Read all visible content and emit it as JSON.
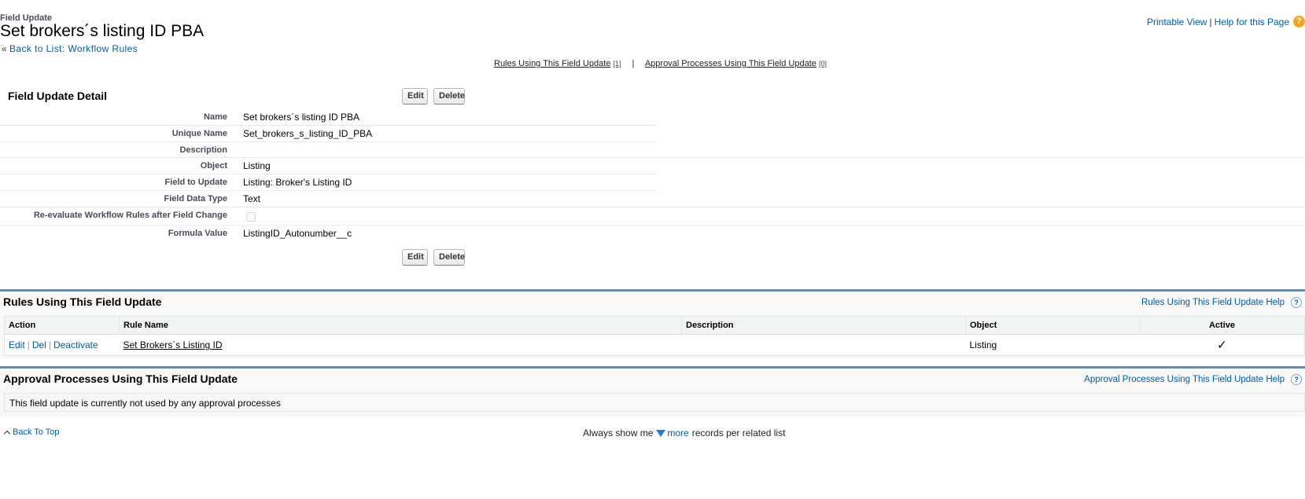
{
  "header": {
    "page_type": "Field Update",
    "title": "Set brokers´s listing ID PBA",
    "back_prefix": "«",
    "back_link": "Back to List: Workflow Rules",
    "printable_view": "Printable View",
    "separator": "|",
    "help_page": "Help for this Page",
    "help_icon": "?"
  },
  "jump_links": {
    "rules": "Rules Using This Field Update",
    "rules_count": "[1]",
    "bar": "|",
    "approvals": "Approval Processes Using This Field Update",
    "approvals_count": "[0]"
  },
  "detail": {
    "title": "Field Update Detail",
    "edit_label": "Edit",
    "delete_label": "Delete",
    "fields": [
      {
        "label": "Name",
        "value": "Set brokers´s listing ID PBA"
      },
      {
        "label": "Unique Name",
        "value": "Set_brokers_s_listing_ID_PBA"
      },
      {
        "label": "Description",
        "value": ""
      },
      {
        "label": "Object",
        "value": "Listing"
      },
      {
        "label": "Field to Update",
        "value": "Listing: Broker's Listing ID"
      },
      {
        "label": "Field Data Type",
        "value": "Text"
      },
      {
        "label": "Re-evaluate Workflow Rules after Field Change",
        "value": ""
      },
      {
        "label": "Formula Value",
        "value": "ListingID_Autonumber__c"
      }
    ],
    "reevaluate_checked": false
  },
  "rules_section": {
    "title": "Rules Using This Field Update",
    "help_link": "Rules Using This Field Update Help",
    "columns": [
      "Action",
      "Rule Name",
      "Description",
      "Object",
      "Active"
    ],
    "rows": [
      {
        "edit": "Edit",
        "del": "Del",
        "deactivate": "Deactivate",
        "pipe": "|",
        "rule_name": "Set Brokers´s Listing ID",
        "description": "",
        "object": "Listing",
        "active": "✓"
      }
    ]
  },
  "approval_section": {
    "title": "Approval Processes Using This Field Update",
    "help_link": "Approval Processes Using This Field Update Help",
    "empty_message": "This field update is currently not used by any approval processes"
  },
  "footer": {
    "back_to_top": "Back To Top",
    "always_show": "Always show me",
    "more": "more",
    "records_per": "records per related list"
  },
  "colors": {
    "link": "#015ba7",
    "section_bar": "#6f8ca3",
    "help_orange": "#f1a526"
  }
}
